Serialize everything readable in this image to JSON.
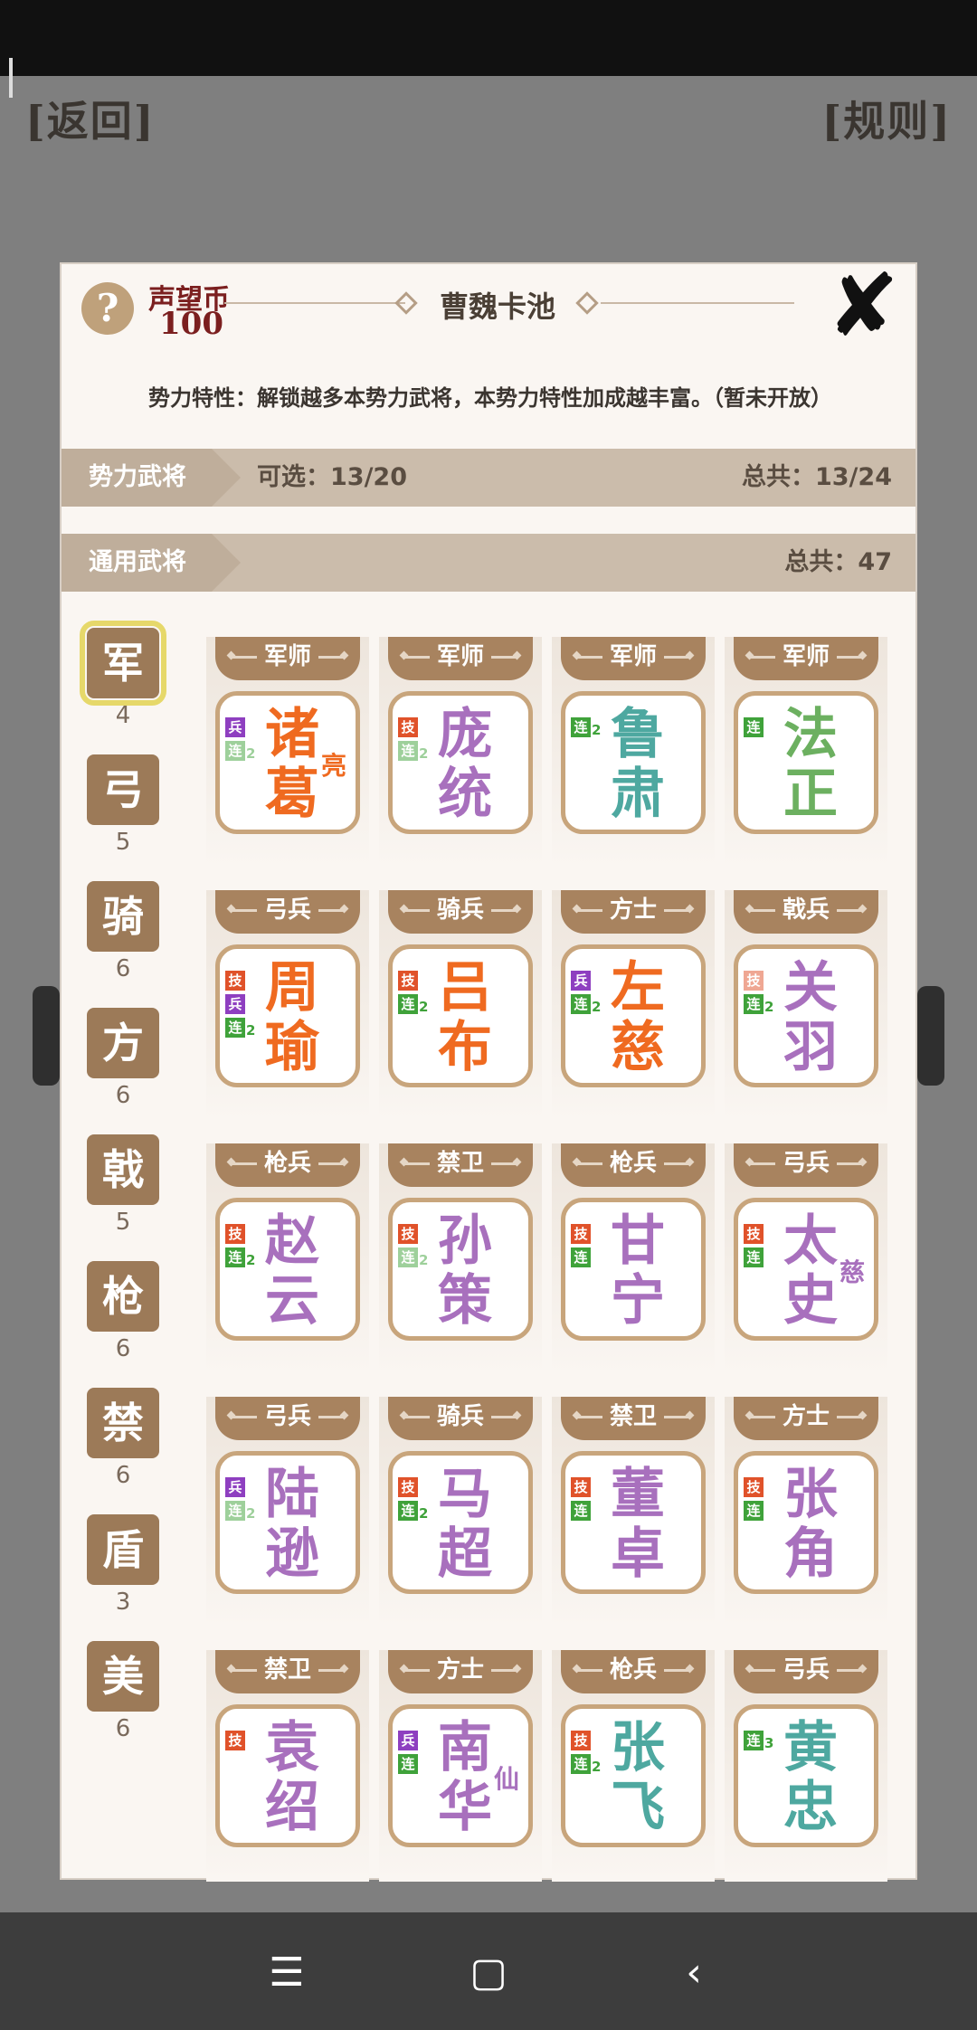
{
  "header": {
    "back_label": "[返回]",
    "rules_label": "[规则]"
  },
  "dialog": {
    "help_icon": "?",
    "coin_label": "声望币",
    "coin_value": "100",
    "title": "曹魏卡池",
    "close_icon": "✘",
    "description": "势力特性：解锁越多本势力武将，本势力特性加成越丰富。（暂未开放）",
    "faction_band": {
      "label": "势力武将",
      "selectable": "可选：13/20",
      "total": "总共：13/24"
    },
    "general_band": {
      "label": "通用武将",
      "total": "总共：47"
    }
  },
  "troop_types": [
    {
      "label": "军",
      "count": "4"
    },
    {
      "label": "弓",
      "count": "5"
    },
    {
      "label": "骑",
      "count": "6"
    },
    {
      "label": "方",
      "count": "6"
    },
    {
      "label": "戟",
      "count": "5"
    },
    {
      "label": "枪",
      "count": "6"
    },
    {
      "label": "禁",
      "count": "6"
    },
    {
      "label": "盾",
      "count": "3"
    },
    {
      "label": "美",
      "count": "6"
    }
  ],
  "cards": [
    {
      "tag": "军师",
      "name1": "诸",
      "name2": "葛",
      "sub": "亮",
      "color": "orange",
      "badges": [
        {
          "t": "兵",
          "k": "bing"
        },
        {
          "t": "连",
          "k": "lian",
          "lv": "2",
          "fade": true
        }
      ]
    },
    {
      "tag": "军师",
      "name1": "庞",
      "name2": "统",
      "sub": "",
      "color": "purple",
      "badges": [
        {
          "t": "技",
          "k": "ji"
        },
        {
          "t": "连",
          "k": "lian",
          "lv": "2",
          "fade": true
        }
      ]
    },
    {
      "tag": "军师",
      "name1": "鲁",
      "name2": "肃",
      "sub": "",
      "color": "teal",
      "badges": [
        {
          "t": "连",
          "k": "lian",
          "lv": "2"
        }
      ]
    },
    {
      "tag": "军师",
      "name1": "法",
      "name2": "正",
      "sub": "",
      "color": "green",
      "badges": [
        {
          "t": "连",
          "k": "lian"
        }
      ]
    },
    {
      "tag": "弓兵",
      "name1": "周",
      "name2": "瑜",
      "sub": "",
      "color": "orange",
      "badges": [
        {
          "t": "技",
          "k": "ji"
        },
        {
          "t": "兵",
          "k": "bing"
        },
        {
          "t": "连",
          "k": "lian",
          "lv": "2"
        }
      ]
    },
    {
      "tag": "骑兵",
      "name1": "吕",
      "name2": "布",
      "sub": "",
      "color": "orange",
      "badges": [
        {
          "t": "技",
          "k": "ji"
        },
        {
          "t": "连",
          "k": "lian",
          "lv": "2"
        }
      ]
    },
    {
      "tag": "方士",
      "name1": "左",
      "name2": "慈",
      "sub": "",
      "color": "orange",
      "badges": [
        {
          "t": "兵",
          "k": "bing"
        },
        {
          "t": "连",
          "k": "lian",
          "lv": "2"
        }
      ]
    },
    {
      "tag": "戟兵",
      "name1": "关",
      "name2": "羽",
      "sub": "",
      "color": "purple",
      "badges": [
        {
          "t": "技",
          "k": "ji",
          "fade": true
        },
        {
          "t": "连",
          "k": "lian",
          "lv": "2"
        }
      ]
    },
    {
      "tag": "枪兵",
      "name1": "赵",
      "name2": "云",
      "sub": "",
      "color": "purple",
      "badges": [
        {
          "t": "技",
          "k": "ji"
        },
        {
          "t": "连",
          "k": "lian",
          "lv": "2"
        }
      ]
    },
    {
      "tag": "禁卫",
      "name1": "孙",
      "name2": "策",
      "sub": "",
      "color": "purple",
      "badges": [
        {
          "t": "技",
          "k": "ji"
        },
        {
          "t": "连",
          "k": "lian",
          "lv": "2",
          "fade": true
        }
      ]
    },
    {
      "tag": "枪兵",
      "name1": "甘",
      "name2": "宁",
      "sub": "",
      "color": "purple",
      "badges": [
        {
          "t": "技",
          "k": "ji"
        },
        {
          "t": "连",
          "k": "lian"
        }
      ]
    },
    {
      "tag": "弓兵",
      "name1": "太",
      "name2": "史",
      "sub": "慈",
      "color": "purple",
      "badges": [
        {
          "t": "技",
          "k": "ji"
        },
        {
          "t": "连",
          "k": "lian"
        }
      ]
    },
    {
      "tag": "弓兵",
      "name1": "陆",
      "name2": "逊",
      "sub": "",
      "color": "purple",
      "badges": [
        {
          "t": "兵",
          "k": "bing"
        },
        {
          "t": "连",
          "k": "lian",
          "lv": "2",
          "fade": true
        }
      ]
    },
    {
      "tag": "骑兵",
      "name1": "马",
      "name2": "超",
      "sub": "",
      "color": "purple",
      "badges": [
        {
          "t": "技",
          "k": "ji"
        },
        {
          "t": "连",
          "k": "lian",
          "lv": "2"
        }
      ]
    },
    {
      "tag": "禁卫",
      "name1": "董",
      "name2": "卓",
      "sub": "",
      "color": "purple",
      "badges": [
        {
          "t": "技",
          "k": "ji"
        },
        {
          "t": "连",
          "k": "lian"
        }
      ]
    },
    {
      "tag": "方士",
      "name1": "张",
      "name2": "角",
      "sub": "",
      "color": "purple",
      "badges": [
        {
          "t": "技",
          "k": "ji"
        },
        {
          "t": "连",
          "k": "lian"
        }
      ]
    },
    {
      "tag": "禁卫",
      "name1": "袁",
      "name2": "绍",
      "sub": "",
      "color": "purple",
      "badges": [
        {
          "t": "技",
          "k": "ji"
        }
      ]
    },
    {
      "tag": "方士",
      "name1": "南",
      "name2": "华",
      "sub": "仙",
      "color": "purple",
      "badges": [
        {
          "t": "兵",
          "k": "bing"
        },
        {
          "t": "连",
          "k": "lian"
        }
      ]
    },
    {
      "tag": "枪兵",
      "name1": "张",
      "name2": "飞",
      "sub": "",
      "color": "teal",
      "badges": [
        {
          "t": "技",
          "k": "ji"
        },
        {
          "t": "连",
          "k": "lian",
          "lv": "2"
        }
      ]
    },
    {
      "tag": "弓兵",
      "name1": "黄",
      "name2": "忠",
      "sub": "",
      "color": "teal",
      "badges": [
        {
          "t": "连",
          "k": "lian",
          "lv": "3"
        }
      ]
    }
  ],
  "nav": {
    "menu_icon": "☰",
    "home_icon": "▢",
    "back_icon": "‹"
  }
}
